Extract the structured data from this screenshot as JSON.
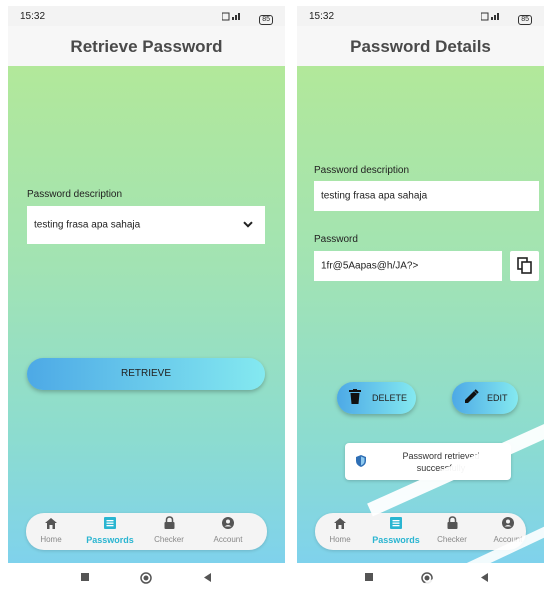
{
  "status_bar": {
    "time": "15:32",
    "battery": "85"
  },
  "screen_retrieve": {
    "title": "Retrieve Password",
    "description_label": "Password description",
    "description_value": "testing frasa apa sahaja",
    "retrieve_label": "RETRIEVE"
  },
  "screen_details": {
    "title": "Password Details",
    "description_label": "Password description",
    "description_value": "testing frasa apa sahaja",
    "password_label": "Password",
    "password_value": "1fr@5Aapas@h/JA?>",
    "delete_label": "DELETE",
    "edit_label": "EDIT",
    "toast_message": "Password retrieved successfully"
  },
  "nav": {
    "items": [
      {
        "label": "Home",
        "icon": "home-icon"
      },
      {
        "label": "Passwords",
        "icon": "list-icon",
        "active": true
      },
      {
        "label": "Checker",
        "icon": "lock-icon"
      },
      {
        "label": "Account",
        "icon": "account-icon"
      }
    ]
  },
  "colors": {
    "accent": "#2ab5d1",
    "gradient_top": "#b2e89a",
    "gradient_bottom": "#7fd2ec"
  }
}
